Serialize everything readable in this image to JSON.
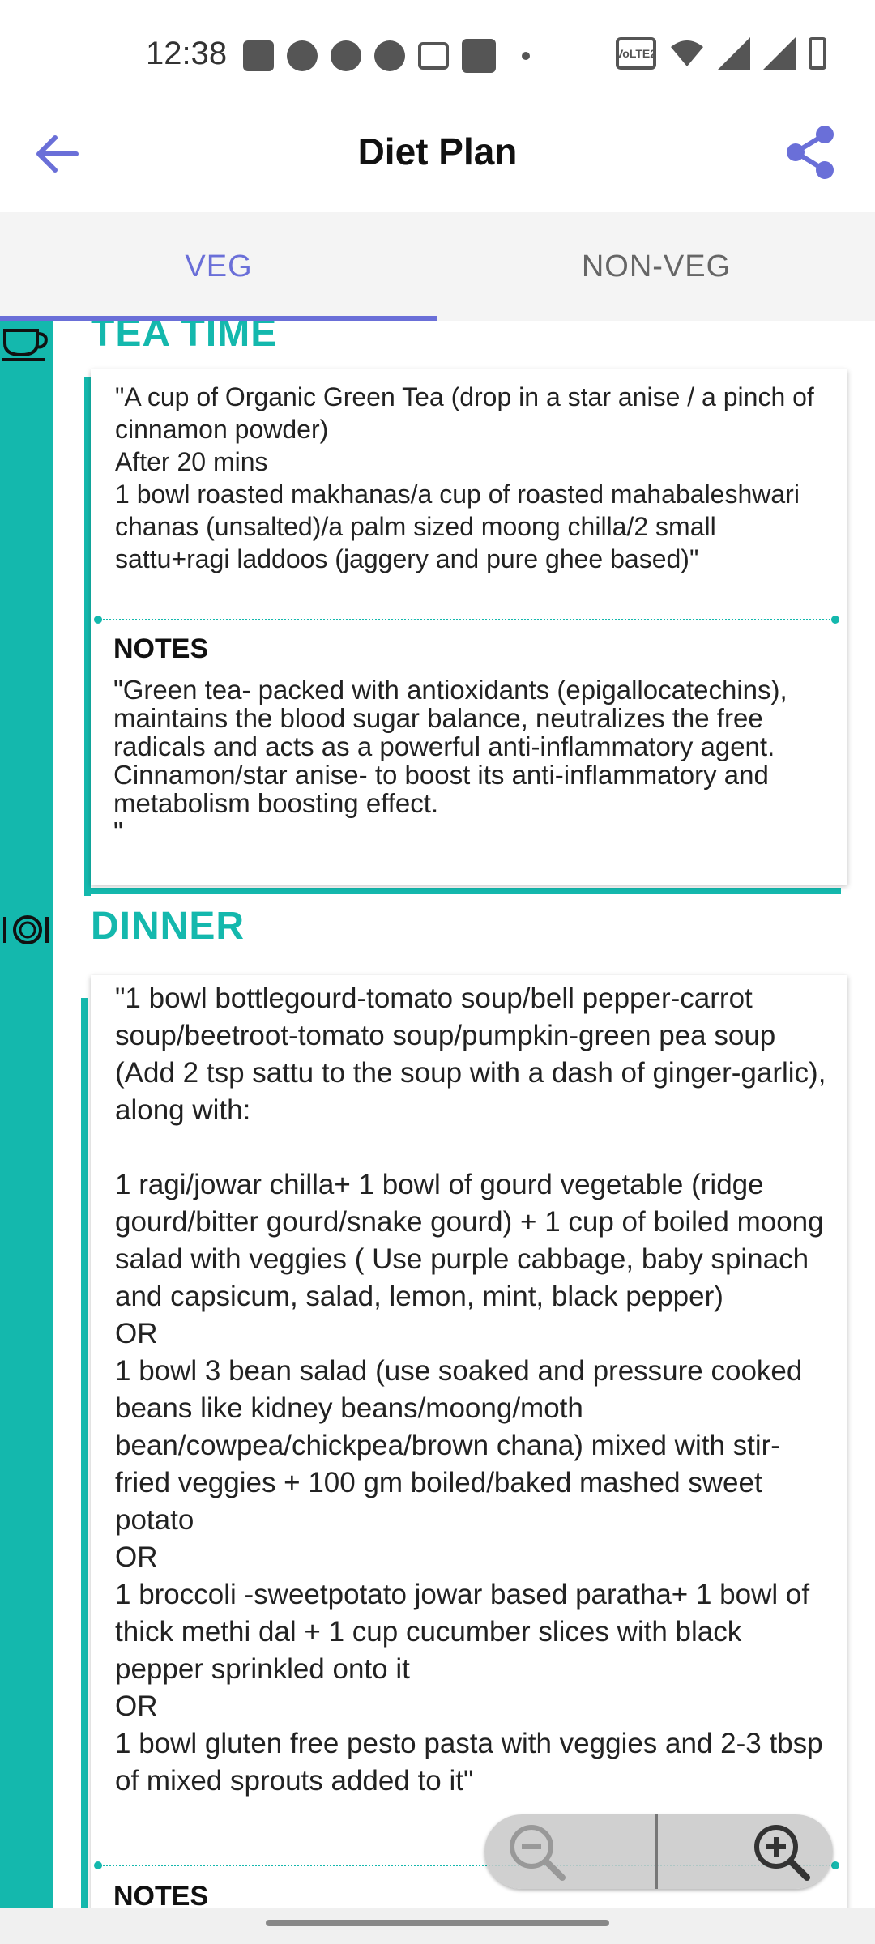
{
  "status_bar": {
    "time": "12:38",
    "network_label": "VoLTE2",
    "left_icons": [
      "notes-icon",
      "chat-bubble-icon",
      "chat-bubble-icon",
      "chat-bubble-icon",
      "gmail-icon",
      "paytm-icon",
      "dot-icon"
    ],
    "right_icons": [
      "volte-icon",
      "wifi-icon",
      "signal-icon",
      "signal-x-icon",
      "battery-charging-icon"
    ]
  },
  "app_bar": {
    "title": "Diet Plan",
    "back_icon": "arrow-left-icon",
    "share_icon": "share-icon",
    "accent_color": "#6a6fd8"
  },
  "tabs": [
    {
      "label": "VEG",
      "selected": true
    },
    {
      "label": "NON-VEG",
      "selected": false
    }
  ],
  "theme": {
    "teal": "#14b8ad"
  },
  "sections": {
    "tea_time": {
      "title": "TEA TIME",
      "icon": "tea-cup-icon",
      "text": "\"A cup of Organic Green Tea (drop in a star anise / a pinch of cinnamon powder)\nAfter 20 mins\n1 bowl roasted makhanas/a cup of roasted mahabaleshwari chanas (unsalted)/a palm sized moong chilla/2 small sattu+ragi laddoos (jaggery and pure ghee based)\"",
      "notes_label": "NOTES",
      "notes": "\"Green tea- packed with antioxidants (epigallocatechins), maintains the blood sugar balance, neutralizes the free radicals and acts as a powerful anti-inflammatory agent. Cinnamon/star anise- to boost its anti-inflammatory and metabolism boosting effect.\n\""
    },
    "dinner": {
      "title": "DINNER",
      "icon": "plate-cutlery-icon",
      "text": "\"1 bowl bottlegourd-tomato soup/bell pepper-carrot soup/beetroot-tomato soup/pumpkin-green pea soup (Add 2 tsp sattu to the soup with a dash of ginger-garlic), along with:\n\n1 ragi/jowar chilla+ 1 bowl of gourd vegetable (ridge gourd/bitter gourd/snake gourd) + 1 cup of boiled moong salad with veggies ( Use purple cabbage, baby spinach and capsicum, salad, lemon, mint, black pepper)\nOR\n1 bowl 3 bean salad (use soaked and pressure cooked beans like kidney beans/moong/moth bean/cowpea/chickpea/brown chana) mixed with stir-fried veggies + 100 gm boiled/baked mashed sweet potato\nOR\n1 broccoli -sweetpotato jowar based paratha+ 1 bowl of thick methi dal + 1 cup cucumber slices with black pepper sprinkled onto it\nOR\n1 bowl gluten free pesto pasta with veggies and 2-3 tbsp of mixed sprouts added to it\"",
      "notes_label": "NOTES"
    }
  },
  "zoom": {
    "out_icon": "zoom-out-icon",
    "in_icon": "zoom-in-icon"
  }
}
